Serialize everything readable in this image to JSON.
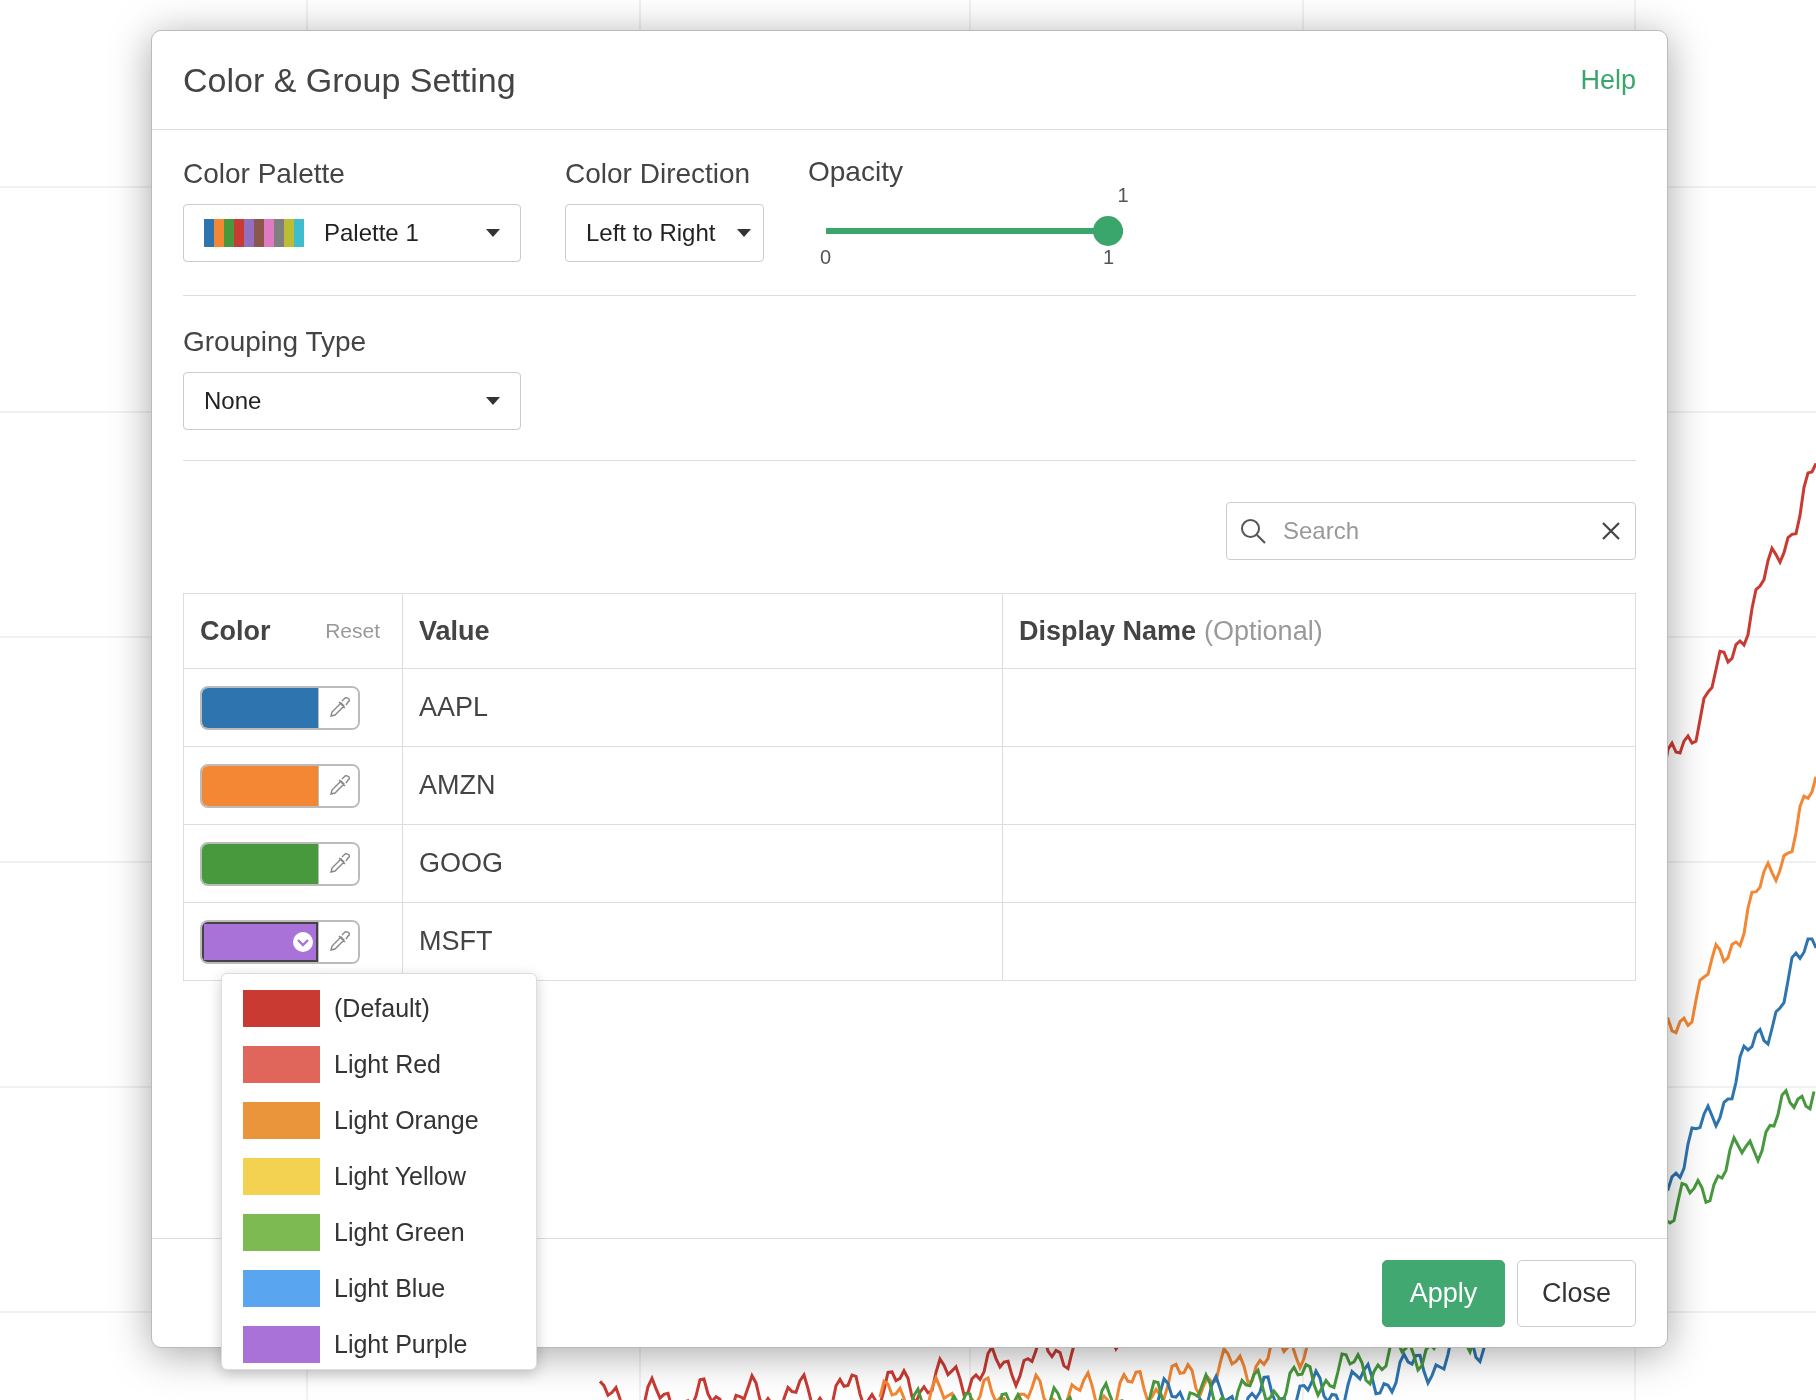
{
  "dialog": {
    "title": "Color & Group Setting",
    "help_link": "Help"
  },
  "color_palette": {
    "label": "Color Palette",
    "value": "Palette 1"
  },
  "color_direction": {
    "label": "Color Direction",
    "value": "Left to Right"
  },
  "opacity": {
    "label": "Opacity",
    "current_label": "1",
    "min_label": "0",
    "max_label": "1",
    "level": 1
  },
  "grouping_type": {
    "label": "Grouping Type",
    "value": "None"
  },
  "search": {
    "placeholder": "Search"
  },
  "table": {
    "columns": [
      {
        "label": "Color",
        "action": "Reset"
      },
      {
        "label": "Value"
      },
      {
        "label": "Display Name",
        "hint": "(Optional)"
      }
    ],
    "rows": [
      {
        "color": "#2e75b0",
        "value": "AAPL",
        "open": false
      },
      {
        "color": "#f38734",
        "value": "AMZN",
        "open": false
      },
      {
        "color": "#48993e",
        "value": "GOOG",
        "open": false
      },
      {
        "color": "#a872d9",
        "value": "MSFT",
        "open": true
      }
    ]
  },
  "color_menu": [
    {
      "label": "(Default)",
      "color": "#c93a32"
    },
    {
      "label": "Light Red",
      "color": "#e0665c"
    },
    {
      "label": "Light Orange",
      "color": "#ea943b"
    },
    {
      "label": "Light Yellow",
      "color": "#f2d250"
    },
    {
      "label": "Light Green",
      "color": "#7dba52"
    },
    {
      "label": "Light Blue",
      "color": "#5aa5ef"
    },
    {
      "label": "Light Purple",
      "color": "#a872d9"
    }
  ],
  "buttons": [
    {
      "label": "Apply",
      "kind": "primary"
    },
    {
      "label": "Close",
      "kind": "default"
    }
  ]
}
